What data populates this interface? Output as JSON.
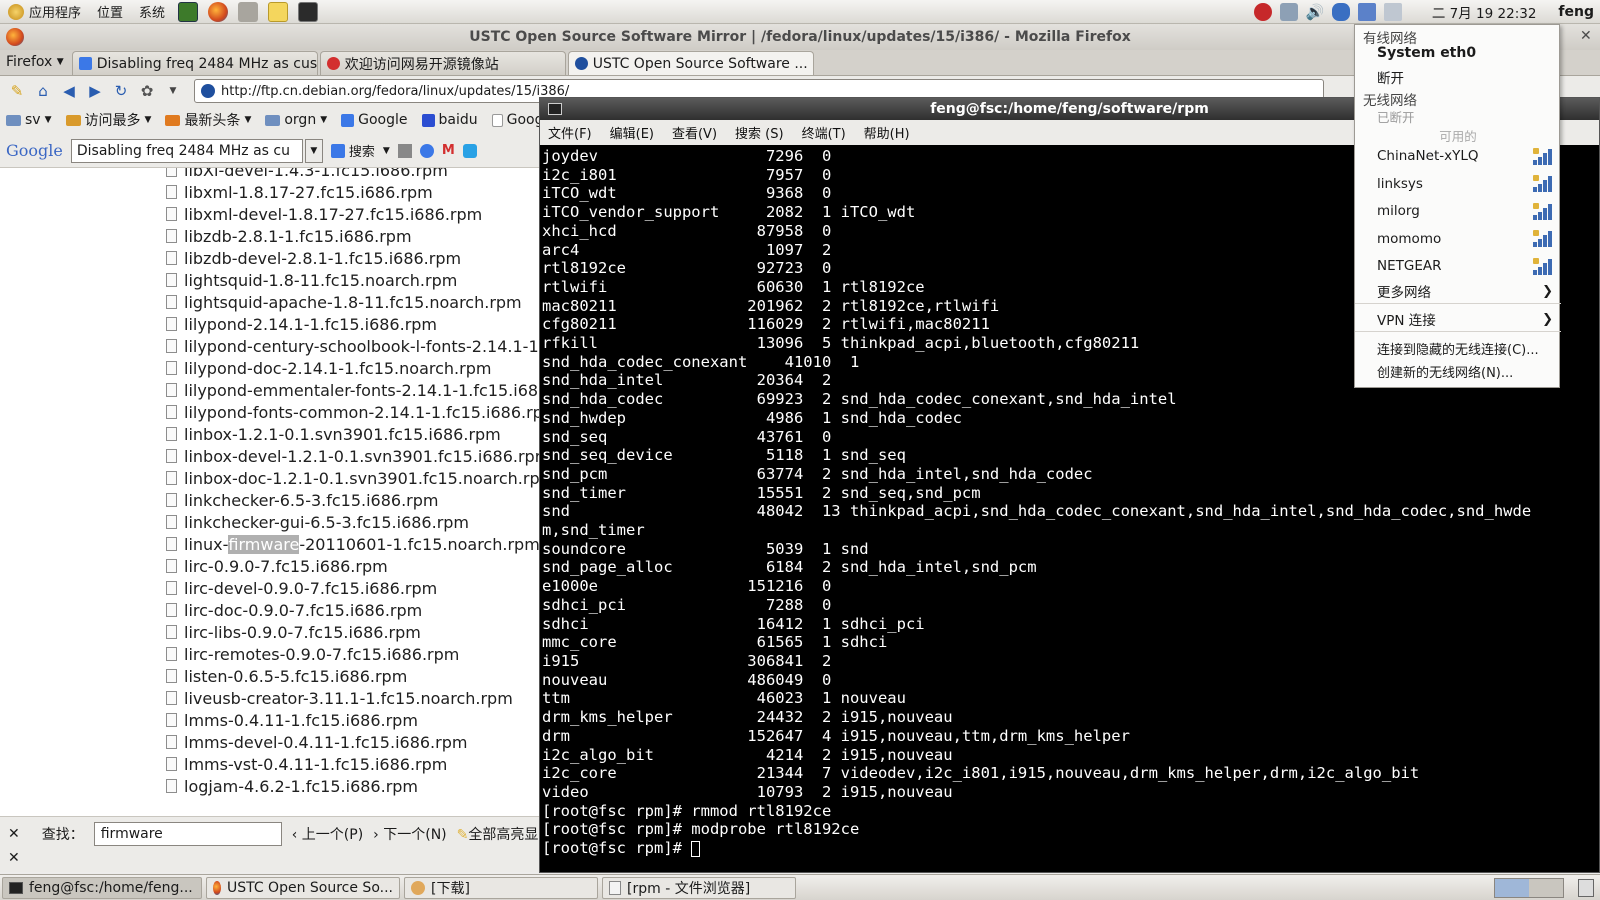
{
  "top_panel": {
    "menus": [
      "应用程序",
      "位置",
      "系统"
    ],
    "clock": "二 7月 19 22:32",
    "user": "feng"
  },
  "firefox": {
    "window_title": "USTC Open Source Software Mirror | /fedora/linux/updates/15/i386/ - Mozilla Firefox",
    "menu_label": "Firefox",
    "tabs": [
      {
        "label": "Disabling freq 2484 MHz as cus..."
      },
      {
        "label": "欢迎访问网易开源镜像站"
      },
      {
        "label": "USTC Open Source Software ..."
      }
    ],
    "url": "http://ftp.cn.debian.org/fedora/linux/updates/15/i386/",
    "bookmarks": [
      "sv",
      "访问最多",
      "最新头条",
      "orgn",
      "Google",
      "baidu",
      "Google"
    ],
    "google_bar": {
      "logo": "Google",
      "query": "Disabling freq 2484 MHz as cu",
      "search_label": "搜索"
    },
    "files": [
      "libXi-devel-1.4.3-1.fc15.i686.rpm",
      "libxml-1.8.17-27.fc15.i686.rpm",
      "libxml-devel-1.8.17-27.fc15.i686.rpm",
      "libzdb-2.8.1-1.fc15.i686.rpm",
      "libzdb-devel-2.8.1-1.fc15.i686.rpm",
      "lightsquid-1.8-11.fc15.noarch.rpm",
      "lightsquid-apache-1.8-11.fc15.noarch.rpm",
      "lilypond-2.14.1-1.fc15.i686.rpm",
      "lilypond-century-schoolbook-l-fonts-2.14.1-1",
      "lilypond-doc-2.14.1-1.fc15.noarch.rpm",
      "lilypond-emmentaler-fonts-2.14.1-1.fc15.i68",
      "lilypond-fonts-common-2.14.1-1.fc15.i686.rp",
      "linbox-1.2.1-0.1.svn3901.fc15.i686.rpm",
      "linbox-devel-1.2.1-0.1.svn3901.fc15.i686.rpr",
      "linbox-doc-1.2.1-0.1.svn3901.fc15.noarch.rp",
      "linkchecker-6.5-3.fc15.i686.rpm",
      "linkchecker-gui-6.5-3.fc15.i686.rpm",
      {
        "pre": "linux-",
        "match": "firmware",
        "post": "-20110601-1.fc15.noarch.rpm"
      },
      "lirc-0.9.0-7.fc15.i686.rpm",
      "lirc-devel-0.9.0-7.fc15.i686.rpm",
      "lirc-doc-0.9.0-7.fc15.i686.rpm",
      "lirc-libs-0.9.0-7.fc15.i686.rpm",
      "lirc-remotes-0.9.0-7.fc15.i686.rpm",
      "listen-0.6.5-5.fc15.i686.rpm",
      "liveusb-creator-3.11.1-1.fc15.noarch.rpm",
      "lmms-0.4.11-1.fc15.i686.rpm",
      "lmms-devel-0.4.11-1.fc15.i686.rpm",
      "lmms-vst-0.4.11-1.fc15.i686.rpm",
      "logjam-4.6.2-1.fc15.i686.rpm"
    ],
    "findbar": {
      "label": "查找：",
      "query": "firmware",
      "prev": "上一个(P)",
      "next": "下一个(N)",
      "highlight_all": "全部高亮显"
    }
  },
  "terminal": {
    "title": "feng@fsc:/home/feng/software/rpm",
    "menu": [
      "文件(F)",
      "编辑(E)",
      "查看(V)",
      "搜索 (S)",
      "终端(T)",
      "帮助(H)"
    ],
    "lines": [
      "joydev                  7296  0",
      "i2c_i801                7957  0",
      "iTCO_wdt                9368  0",
      "iTCO_vendor_support     2082  1 iTCO_wdt",
      "xhci_hcd               87958  0",
      "arc4                    1097  2",
      "rtl8192ce              92723  0",
      "rtlwifi                60630  1 rtl8192ce",
      "mac80211              201962  2 rtl8192ce,rtlwifi",
      "cfg80211              116029  2 rtlwifi,mac80211",
      "rfkill                 13096  5 thinkpad_acpi,bluetooth,cfg80211",
      "snd_hda_codec_conexant    41010  1",
      "snd_hda_intel          20364  2",
      "snd_hda_codec          69923  2 snd_hda_codec_conexant,snd_hda_intel",
      "snd_hwdep               4986  1 snd_hda_codec",
      "snd_seq                43761  0",
      "snd_seq_device          5118  1 snd_seq",
      "snd_pcm                63774  2 snd_hda_intel,snd_hda_codec",
      "snd_timer              15551  2 snd_seq,snd_pcm",
      "snd                    48042  13 thinkpad_acpi,snd_hda_codec_conexant,snd_hda_intel,snd_hda_codec,snd_hwde",
      "m,snd_timer",
      "soundcore               5039  1 snd",
      "snd_page_alloc          6184  2 snd_hda_intel,snd_pcm",
      "e1000e                151216  0",
      "sdhci_pci               7288  0",
      "sdhci                  16412  1 sdhci_pci",
      "mmc_core               61565  1 sdhci",
      "i915                  306841  2",
      "nouveau               486049  0",
      "ttm                    46023  1 nouveau",
      "drm_kms_helper         24432  2 i915,nouveau",
      "drm                   152647  4 i915,nouveau,ttm,drm_kms_helper",
      "i2c_algo_bit            4214  2 i915,nouveau",
      "i2c_core               21344  7 videodev,i2c_i801,i915,nouveau,drm_kms_helper,drm,i2c_algo_bit",
      "video                  10793  2 i915,nouveau",
      "[root@fsc rpm]# rmmod rtl8192ce",
      "[root@fsc rpm]# modprobe rtl8192ce"
    ],
    "prompt": "[root@fsc rpm]# "
  },
  "network_menu": {
    "wired_header": "有线网络",
    "wired_device": "System eth0",
    "wired_disconnect": "断开",
    "wireless_header": "无线网络",
    "wireless_status": "已断开",
    "available": "可用的",
    "networks": [
      "ChinaNet-xYLQ",
      "linksys",
      "milorg",
      "momomo",
      "NETGEAR"
    ],
    "more": "更多网络",
    "vpn": "VPN 连接",
    "hidden": "连接到隐藏的无线连接(C)...",
    "create": "创建新的无线网络(N)..."
  },
  "taskbar": [
    {
      "label": "feng@fsc:/home/feng..."
    },
    {
      "label": "USTC Open Source So..."
    },
    {
      "label": "[下载]"
    },
    {
      "label": "[rpm - 文件浏览器]"
    }
  ],
  "colors": {
    "terminal_bg": "#000000",
    "terminal_fg": "#ffffff",
    "find_highlight": "#b0b0b0",
    "link_blue": "#2a5db0"
  }
}
